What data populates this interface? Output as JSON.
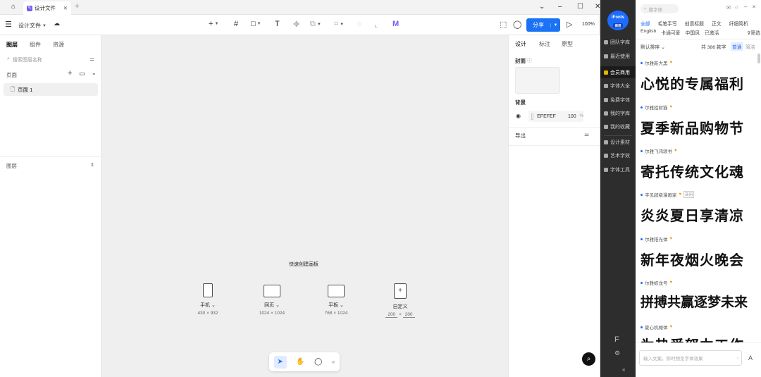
{
  "tabbar": {
    "home_icon": "home-icon",
    "tab_title": "设计文件",
    "close": "✕",
    "add": "+"
  },
  "window": {
    "minimize": "–",
    "maximize": "☐"
  },
  "toolbar": {
    "file_name": "设计文件",
    "share_label": "分享",
    "zoom": "100%"
  },
  "left_panel": {
    "tabs": [
      "图层",
      "组件",
      "资源"
    ],
    "search_placeholder": "搜索图层名称",
    "pages_label": "页面",
    "page_item": "页面 1",
    "layers_label": "图层"
  },
  "canvas": {
    "quick_create_title": "快速创建画板",
    "presets": [
      {
        "label": "手机",
        "dims": "430 × 932"
      },
      {
        "label": "网页",
        "dims": "1024 × 1024"
      },
      {
        "label": "平板",
        "dims": "768 × 1024"
      },
      {
        "label": "自定义",
        "w": "200",
        "x": "×",
        "h": "200"
      }
    ]
  },
  "right_panel": {
    "tabs": [
      "设计",
      "标注",
      "原型"
    ],
    "cover_label": "封面",
    "background_label": "背景",
    "bg_hex": "EFEFEF",
    "bg_opacity": "100",
    "bg_pct": "%",
    "export_label": "导出"
  },
  "ifonts": {
    "logo": "iFonts",
    "version": "商用",
    "nav": [
      "团队字库",
      "最近使用",
      "会员商用",
      "字体大全",
      "免费字体",
      "我的字库",
      "我的收藏",
      "设计素材",
      "艺术字效",
      "字体工具"
    ],
    "search_placeholder": "搜字体",
    "categories_row1": [
      "全部",
      "毛笔手写",
      "创意标题",
      "正文",
      "纤细简析"
    ],
    "categories_row2": [
      "English",
      "卡通可爱",
      "中国风",
      "已激活",
      "筛选"
    ],
    "sort_label": "默认排序",
    "count_label": "共 386 款字",
    "mode_normal": "普通",
    "mode_simple": "简洁",
    "fonts": [
      {
        "name": "尔雅新大黑",
        "sample": "心悦的专属福利"
      },
      {
        "name": "尔雅招财猫",
        "sample": "夏季新品购物节"
      },
      {
        "name": "尔雅飞鸿颂书",
        "sample": "寄托传统文化魂"
      },
      {
        "name": "字见超级漫画家",
        "tag": "商用",
        "sample": "炎炎夏日享清凉"
      },
      {
        "name": "尔雅阳光体",
        "sample": "新年夜烟火晚会"
      },
      {
        "name": "尔雅蛟龙号",
        "sample": "拼搏共赢逐梦未来"
      },
      {
        "name": "夏心机械体",
        "sample": "为热爱努力工作"
      }
    ],
    "input_placeholder": "输入文案，即时预览字体效果",
    "input_button": "A"
  },
  "colors": {
    "accent": "#1a73f5",
    "dark_nav": "#2d2d2d",
    "ifonts_blue": "#1d6cff",
    "canvas_bg": "#efefef"
  }
}
